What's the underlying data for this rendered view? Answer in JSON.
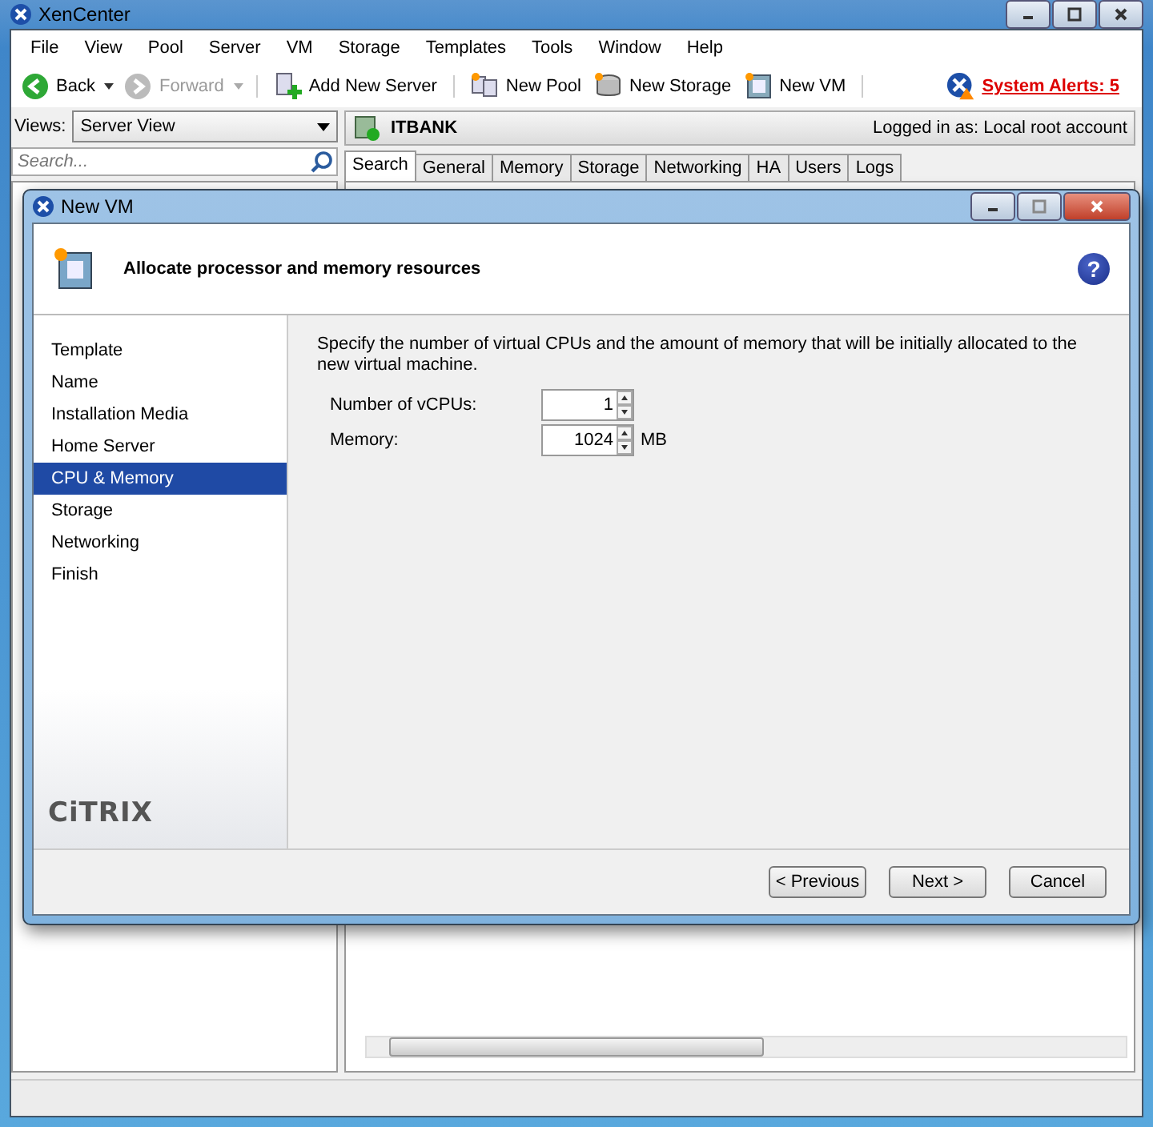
{
  "window": {
    "title": "XenCenter"
  },
  "menu": [
    "File",
    "View",
    "Pool",
    "Server",
    "VM",
    "Storage",
    "Templates",
    "Tools",
    "Window",
    "Help"
  ],
  "toolbar": [
    {
      "label": "Back",
      "kind": "back",
      "disabled": false
    },
    {
      "label": "Forward",
      "kind": "forward",
      "disabled": true
    },
    {
      "label": "Add New Server",
      "kind": "server",
      "disabled": false
    },
    {
      "label": "New Pool",
      "kind": "pool",
      "disabled": false
    },
    {
      "label": "New Storage",
      "kind": "storage",
      "disabled": false
    },
    {
      "label": "New VM",
      "kind": "vm",
      "disabled": false
    }
  ],
  "alerts": {
    "label": "System Alerts: 5"
  },
  "views": {
    "label": "Views:",
    "value": "Server View"
  },
  "search": {
    "placeholder": "Search..."
  },
  "server_header": {
    "name": "ITBANK",
    "login": "Logged in as: Local root account"
  },
  "tabs": [
    {
      "label": "Search",
      "selected": true
    },
    {
      "label": "General",
      "selected": false
    },
    {
      "label": "Memory",
      "selected": false
    },
    {
      "label": "Storage",
      "selected": false
    },
    {
      "label": "Networking",
      "selected": false
    },
    {
      "label": "HA",
      "selected": false
    },
    {
      "label": "Users",
      "selected": false
    },
    {
      "label": "Logs",
      "selected": false
    }
  ],
  "dialog": {
    "title": "New VM",
    "heading": "Allocate processor and memory resources",
    "help": "?",
    "steps": [
      {
        "label": "Template",
        "selected": false
      },
      {
        "label": "Name",
        "selected": false
      },
      {
        "label": "Installation Media",
        "selected": false
      },
      {
        "label": "Home Server",
        "selected": false
      },
      {
        "label": "CPU & Memory",
        "selected": true
      },
      {
        "label": "Storage",
        "selected": false
      },
      {
        "label": "Networking",
        "selected": false
      },
      {
        "label": "Finish",
        "selected": false
      }
    ],
    "logo": "CiTRIX",
    "description": "Specify the number of virtual CPUs and the amount of memory that will be initially allocated to the new virtual machine.",
    "fields": [
      {
        "label": "Number of vCPUs:",
        "value": "1"
      },
      {
        "label": "Memory:",
        "value": "1024",
        "unit": "MB"
      }
    ],
    "buttons": [
      "< Previous",
      "Next >",
      "Cancel"
    ]
  }
}
